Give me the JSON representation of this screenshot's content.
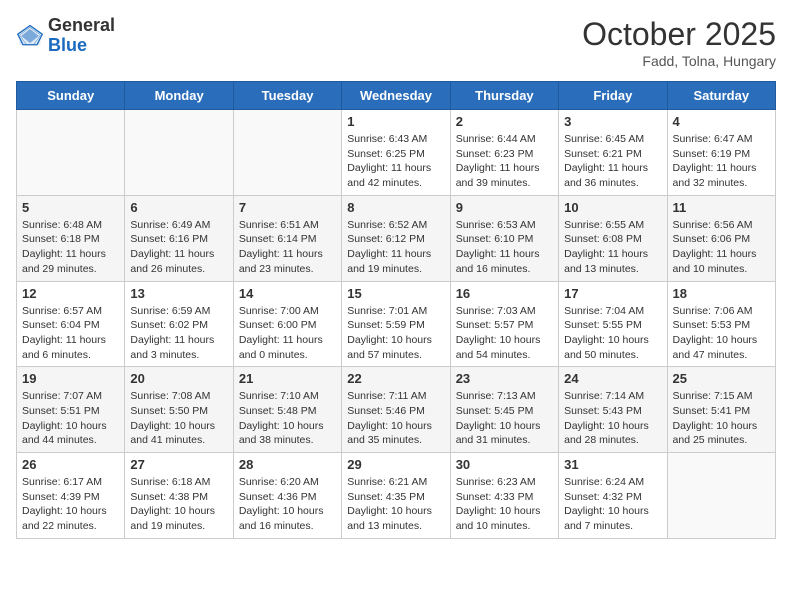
{
  "header": {
    "logo_general": "General",
    "logo_blue": "Blue",
    "title": "October 2025",
    "subtitle": "Fadd, Tolna, Hungary"
  },
  "days_of_week": [
    "Sunday",
    "Monday",
    "Tuesday",
    "Wednesday",
    "Thursday",
    "Friday",
    "Saturday"
  ],
  "weeks": [
    [
      {
        "day": "",
        "info": ""
      },
      {
        "day": "",
        "info": ""
      },
      {
        "day": "",
        "info": ""
      },
      {
        "day": "1",
        "info": "Sunrise: 6:43 AM\nSunset: 6:25 PM\nDaylight: 11 hours and 42 minutes."
      },
      {
        "day": "2",
        "info": "Sunrise: 6:44 AM\nSunset: 6:23 PM\nDaylight: 11 hours and 39 minutes."
      },
      {
        "day": "3",
        "info": "Sunrise: 6:45 AM\nSunset: 6:21 PM\nDaylight: 11 hours and 36 minutes."
      },
      {
        "day": "4",
        "info": "Sunrise: 6:47 AM\nSunset: 6:19 PM\nDaylight: 11 hours and 32 minutes."
      }
    ],
    [
      {
        "day": "5",
        "info": "Sunrise: 6:48 AM\nSunset: 6:18 PM\nDaylight: 11 hours and 29 minutes."
      },
      {
        "day": "6",
        "info": "Sunrise: 6:49 AM\nSunset: 6:16 PM\nDaylight: 11 hours and 26 minutes."
      },
      {
        "day": "7",
        "info": "Sunrise: 6:51 AM\nSunset: 6:14 PM\nDaylight: 11 hours and 23 minutes."
      },
      {
        "day": "8",
        "info": "Sunrise: 6:52 AM\nSunset: 6:12 PM\nDaylight: 11 hours and 19 minutes."
      },
      {
        "day": "9",
        "info": "Sunrise: 6:53 AM\nSunset: 6:10 PM\nDaylight: 11 hours and 16 minutes."
      },
      {
        "day": "10",
        "info": "Sunrise: 6:55 AM\nSunset: 6:08 PM\nDaylight: 11 hours and 13 minutes."
      },
      {
        "day": "11",
        "info": "Sunrise: 6:56 AM\nSunset: 6:06 PM\nDaylight: 11 hours and 10 minutes."
      }
    ],
    [
      {
        "day": "12",
        "info": "Sunrise: 6:57 AM\nSunset: 6:04 PM\nDaylight: 11 hours and 6 minutes."
      },
      {
        "day": "13",
        "info": "Sunrise: 6:59 AM\nSunset: 6:02 PM\nDaylight: 11 hours and 3 minutes."
      },
      {
        "day": "14",
        "info": "Sunrise: 7:00 AM\nSunset: 6:00 PM\nDaylight: 11 hours and 0 minutes."
      },
      {
        "day": "15",
        "info": "Sunrise: 7:01 AM\nSunset: 5:59 PM\nDaylight: 10 hours and 57 minutes."
      },
      {
        "day": "16",
        "info": "Sunrise: 7:03 AM\nSunset: 5:57 PM\nDaylight: 10 hours and 54 minutes."
      },
      {
        "day": "17",
        "info": "Sunrise: 7:04 AM\nSunset: 5:55 PM\nDaylight: 10 hours and 50 minutes."
      },
      {
        "day": "18",
        "info": "Sunrise: 7:06 AM\nSunset: 5:53 PM\nDaylight: 10 hours and 47 minutes."
      }
    ],
    [
      {
        "day": "19",
        "info": "Sunrise: 7:07 AM\nSunset: 5:51 PM\nDaylight: 10 hours and 44 minutes."
      },
      {
        "day": "20",
        "info": "Sunrise: 7:08 AM\nSunset: 5:50 PM\nDaylight: 10 hours and 41 minutes."
      },
      {
        "day": "21",
        "info": "Sunrise: 7:10 AM\nSunset: 5:48 PM\nDaylight: 10 hours and 38 minutes."
      },
      {
        "day": "22",
        "info": "Sunrise: 7:11 AM\nSunset: 5:46 PM\nDaylight: 10 hours and 35 minutes."
      },
      {
        "day": "23",
        "info": "Sunrise: 7:13 AM\nSunset: 5:45 PM\nDaylight: 10 hours and 31 minutes."
      },
      {
        "day": "24",
        "info": "Sunrise: 7:14 AM\nSunset: 5:43 PM\nDaylight: 10 hours and 28 minutes."
      },
      {
        "day": "25",
        "info": "Sunrise: 7:15 AM\nSunset: 5:41 PM\nDaylight: 10 hours and 25 minutes."
      }
    ],
    [
      {
        "day": "26",
        "info": "Sunrise: 6:17 AM\nSunset: 4:39 PM\nDaylight: 10 hours and 22 minutes."
      },
      {
        "day": "27",
        "info": "Sunrise: 6:18 AM\nSunset: 4:38 PM\nDaylight: 10 hours and 19 minutes."
      },
      {
        "day": "28",
        "info": "Sunrise: 6:20 AM\nSunset: 4:36 PM\nDaylight: 10 hours and 16 minutes."
      },
      {
        "day": "29",
        "info": "Sunrise: 6:21 AM\nSunset: 4:35 PM\nDaylight: 10 hours and 13 minutes."
      },
      {
        "day": "30",
        "info": "Sunrise: 6:23 AM\nSunset: 4:33 PM\nDaylight: 10 hours and 10 minutes."
      },
      {
        "day": "31",
        "info": "Sunrise: 6:24 AM\nSunset: 4:32 PM\nDaylight: 10 hours and 7 minutes."
      },
      {
        "day": "",
        "info": ""
      }
    ]
  ]
}
